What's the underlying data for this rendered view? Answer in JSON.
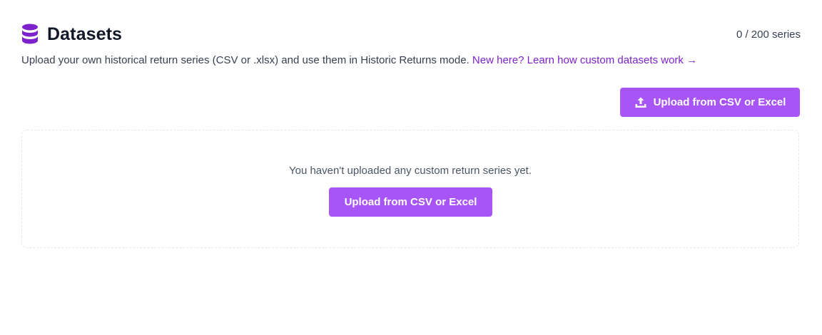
{
  "header": {
    "title": "Datasets",
    "icon": "database-icon",
    "series_count": "0 / 200 series"
  },
  "subtitle": {
    "text": "Upload your own historical return series (CSV or .xlsx) and use them in Historic Returns mode. ",
    "link_text": "New here? Learn how custom datasets work →"
  },
  "toolbar": {
    "upload_label": "Upload from CSV or Excel",
    "upload_icon": "upload-icon"
  },
  "empty_state": {
    "message": "You haven't uploaded any custom return series yet.",
    "upload_label": "Upload from CSV or Excel"
  },
  "colors": {
    "accent": "#a855f7",
    "link": "#7e22ce",
    "icon": "#7e22ce"
  }
}
